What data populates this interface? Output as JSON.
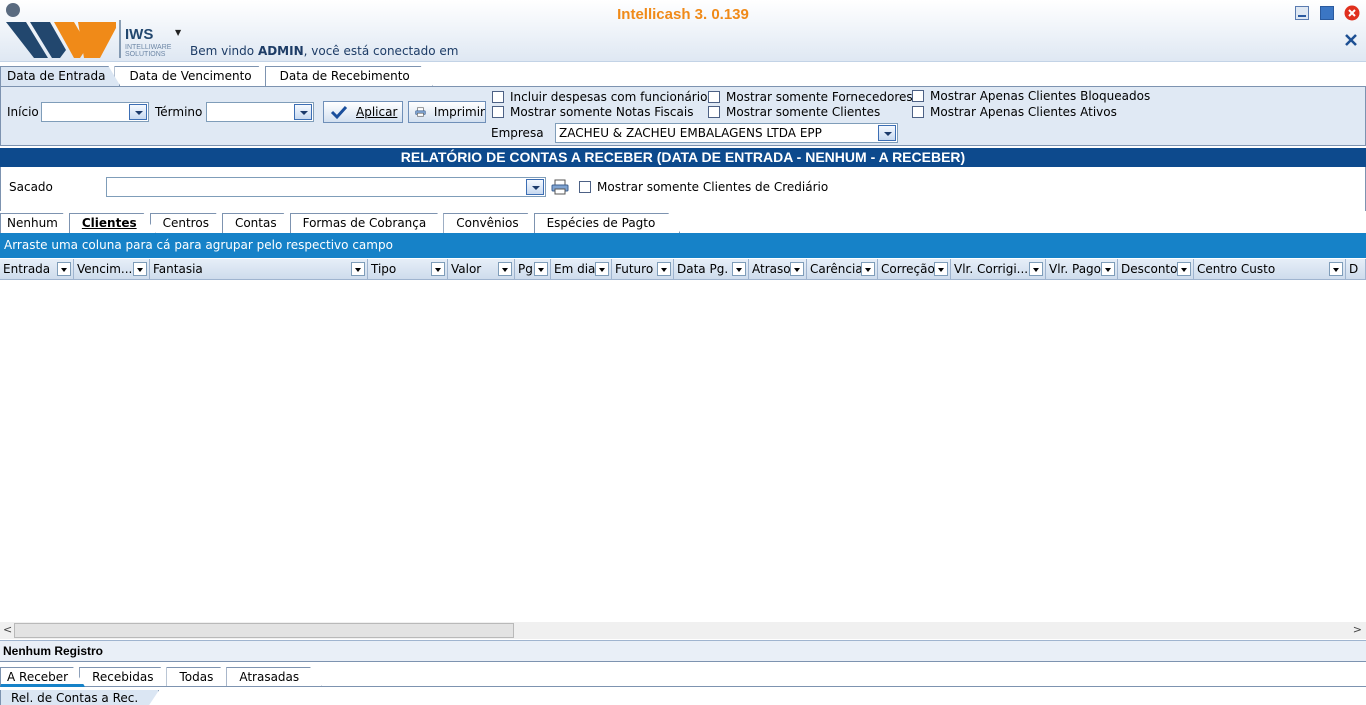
{
  "app": {
    "title": "Intellicash 3. 0.139",
    "brand": "IWS",
    "brand_sub_1": "INTELLIWARE",
    "brand_sub_2": "SOLUTIONS",
    "welcome_prefix": "Bem vindo ",
    "welcome_user": "ADMIN",
    "welcome_suffix": ", você está conectado em",
    "accent_color": "#f08a18",
    "header_blue": "#0d4a8d"
  },
  "date_tabs": [
    {
      "label": "Data de Entrada",
      "active": true
    },
    {
      "label": "Data de Vencimento",
      "active": false
    },
    {
      "label": "Data de Recebimento",
      "active": false
    }
  ],
  "filters": {
    "inicio_label": "Início",
    "inicio_value": "",
    "termino_label": "Término",
    "termino_value": "",
    "aplicar_label": "Aplicar",
    "imprimir_label": "Imprimir",
    "empresa_label": "Empresa",
    "empresa_value": "ZACHEU & ZACHEU EMBALAGENS LTDA EPP",
    "checkboxes": [
      {
        "label": "Incluir despesas com funcionários",
        "checked": false
      },
      {
        "label": "Mostrar somente Notas Fiscais",
        "checked": false
      },
      {
        "label": "Mostrar somente Fornecedores",
        "checked": false
      },
      {
        "label": "Mostrar somente Clientes",
        "checked": false
      },
      {
        "label": "Mostrar Apenas Clientes Bloqueados",
        "checked": false
      },
      {
        "label": "Mostrar Apenas Clientes Ativos",
        "checked": false
      }
    ]
  },
  "report": {
    "title": "RELATÓRIO DE CONTAS A RECEBER (DATA DE ENTRADA - NENHUM - A RECEBER)"
  },
  "sacado": {
    "label": "Sacado",
    "value": "",
    "credit_checkbox_label": "Mostrar somente Clientes de Crediário",
    "credit_checked": false
  },
  "group_tabs": [
    {
      "label": "Nenhum",
      "active": false
    },
    {
      "label": "Clientes",
      "active": true
    },
    {
      "label": "Centros",
      "active": false
    },
    {
      "label": "Contas",
      "active": false
    },
    {
      "label": "Formas de Cobrança",
      "active": false
    },
    {
      "label": "Convênios",
      "active": false
    },
    {
      "label": "Espécies de Pagto",
      "active": false
    }
  ],
  "grid": {
    "group_hint": "Arraste uma coluna para cá para agrupar pelo respectivo campo",
    "columns": [
      "Entrada",
      "Vencim...",
      "Fantasia",
      "Tipo",
      "Valor",
      "Pg",
      "Em dia",
      "Futuro",
      "Data Pg.",
      "Atraso",
      "Carência",
      "Correção",
      "Vlr. Corrigi...",
      "Vlr. Pago",
      "Desconto",
      "Centro Custo",
      "D"
    ],
    "rows": []
  },
  "status": {
    "text": "Nenhum Registro"
  },
  "status_tabs": [
    {
      "label": "A Receber",
      "active": true
    },
    {
      "label": "Recebidas",
      "active": false
    },
    {
      "label": "Todas",
      "active": false
    },
    {
      "label": "Atrasadas",
      "active": false
    }
  ],
  "report_tab": {
    "label": "Rel. de Contas a Rec."
  }
}
